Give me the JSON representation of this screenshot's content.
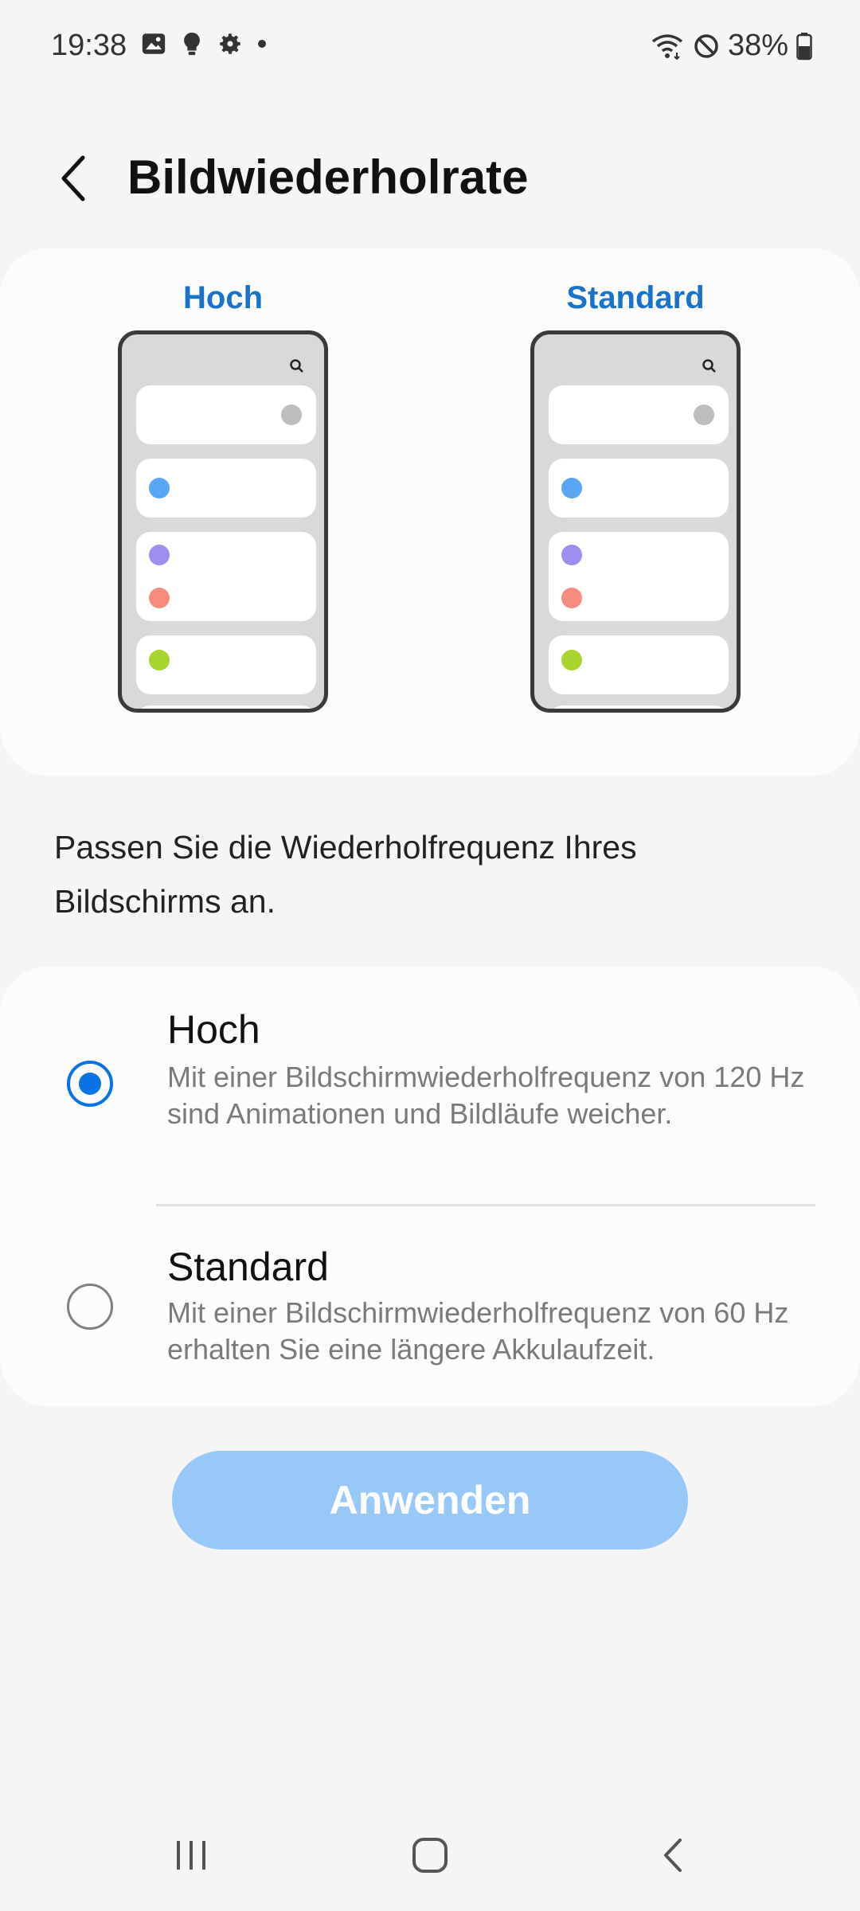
{
  "status_bar": {
    "time": "19:38",
    "battery": "38%",
    "left_icons": [
      "gallery-icon",
      "bulb-icon",
      "gear-icon",
      "dot-icon"
    ],
    "right_icons": [
      "wifi-icon",
      "do-not-disturb-icon",
      "battery-icon"
    ]
  },
  "app_bar": {
    "title": "Bildwiederholrate"
  },
  "preview": {
    "high_label": "Hoch",
    "standard_label": "Standard"
  },
  "description": "Passen Sie die Wiederholfrequenz Ihres Bildschirms an.",
  "options": [
    {
      "title": "Hoch",
      "description": "Mit einer Bildschirmwiederholfrequenz von 120 Hz sind Animationen und Bildläufe weicher.",
      "selected": true
    },
    {
      "title": "Standard",
      "description": "Mit einer Bildschirmwiederholfrequenz von 60 Hz erhalten Sie eine längere Akkulaufzeit.",
      "selected": false
    }
  ],
  "apply_button": "Anwenden",
  "colors": {
    "accent": "#0a72e6",
    "preview_label": "#1a73c9",
    "apply_disabled": "#98c8f7",
    "dot_gray": "#bdbdbd",
    "dot_blue": "#5aa5f4",
    "dot_purple": "#9d8ff0",
    "dot_red": "#f58c7f",
    "dot_green": "#a8d42f"
  },
  "nav_bar": {
    "icons": [
      "recent-apps-icon",
      "home-icon",
      "back-nav-icon"
    ]
  }
}
